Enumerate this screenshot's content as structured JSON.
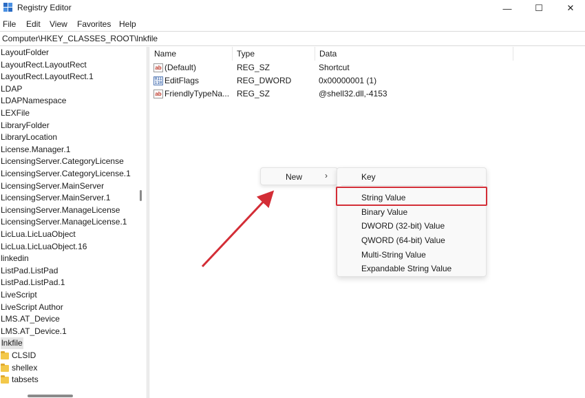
{
  "window": {
    "title": "Registry Editor",
    "minimize": "—",
    "maximize": "☐",
    "close": "✕"
  },
  "menu": [
    "File",
    "Edit",
    "View",
    "Favorites",
    "Help"
  ],
  "address": "Computer\\HKEY_CLASSES_ROOT\\lnkfile",
  "tree": [
    {
      "label": "LayoutFolder"
    },
    {
      "label": "LayoutRect.LayoutRect"
    },
    {
      "label": "LayoutRect.LayoutRect.1"
    },
    {
      "label": "LDAP"
    },
    {
      "label": "LDAPNamespace"
    },
    {
      "label": "LEXFile"
    },
    {
      "label": "LibraryFolder"
    },
    {
      "label": "LibraryLocation"
    },
    {
      "label": "License.Manager.1"
    },
    {
      "label": "LicensingServer.CategoryLicense"
    },
    {
      "label": "LicensingServer.CategoryLicense.1"
    },
    {
      "label": "LicensingServer.MainServer"
    },
    {
      "label": "LicensingServer.MainServer.1"
    },
    {
      "label": "LicensingServer.ManageLicense"
    },
    {
      "label": "LicensingServer.ManageLicense.1"
    },
    {
      "label": "LicLua.LicLuaObject"
    },
    {
      "label": "LicLua.LicLuaObject.16"
    },
    {
      "label": "linkedin"
    },
    {
      "label": "ListPad.ListPad"
    },
    {
      "label": "ListPad.ListPad.1"
    },
    {
      "label": "LiveScript"
    },
    {
      "label": "LiveScript Author"
    },
    {
      "label": "LMS.AT_Device"
    },
    {
      "label": "LMS.AT_Device.1"
    },
    {
      "label": "lnkfile",
      "selected": true
    },
    {
      "label": "CLSID",
      "folder": true
    },
    {
      "label": "shellex",
      "folder": true
    },
    {
      "label": "tabsets",
      "folder": true
    }
  ],
  "columns": {
    "name": "Name",
    "type": "Type",
    "data": "Data"
  },
  "values": [
    {
      "icon": "string-value-icon",
      "name": "(Default)",
      "type": "REG_SZ",
      "data": "Shortcut"
    },
    {
      "icon": "binary-value-icon",
      "name": "EditFlags",
      "type": "REG_DWORD",
      "data": "0x00000001 (1)"
    },
    {
      "icon": "string-value-icon",
      "name": "FriendlyTypeNa...",
      "type": "REG_SZ",
      "data": "@shell32.dll,-4153"
    }
  ],
  "context_menu": {
    "new_label": "New",
    "arrow": "›"
  },
  "submenu": [
    "Key",
    "String Value",
    "Binary Value",
    "DWORD (32-bit) Value",
    "QWORD (64-bit) Value",
    "Multi-String Value",
    "Expandable String Value"
  ],
  "colors": {
    "annotation": "#d32d36",
    "selection": "#e5e5e5",
    "folder": "#f3c84a"
  }
}
